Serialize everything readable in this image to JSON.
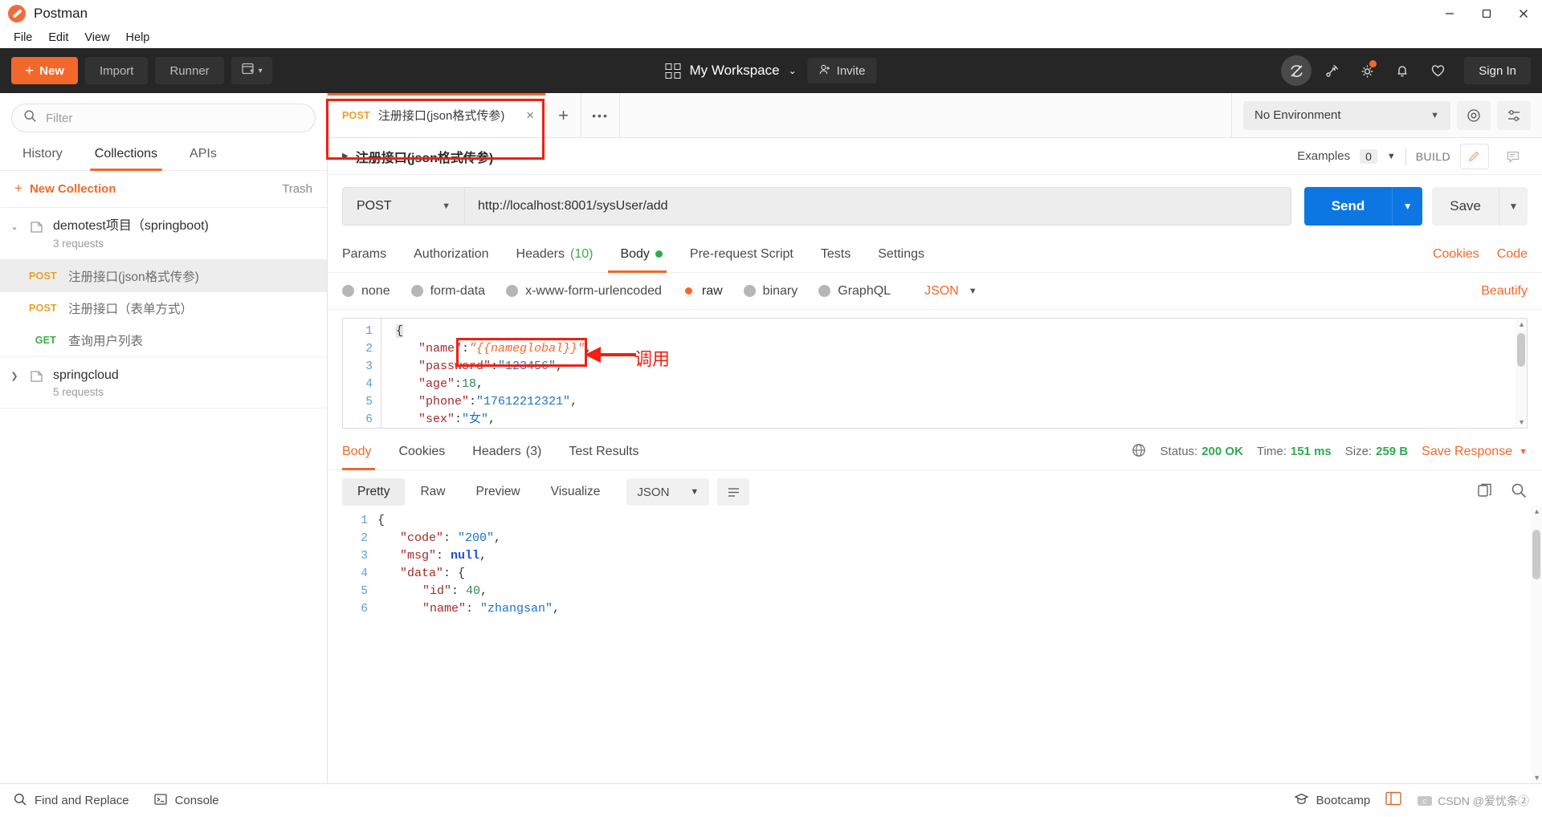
{
  "window": {
    "app_title": "Postman",
    "minimize": "minimize-icon",
    "maximize": "maximize-icon",
    "close": "close-icon"
  },
  "menubar": {
    "items": [
      "File",
      "Edit",
      "View",
      "Help"
    ]
  },
  "toolbar": {
    "new_label": "New",
    "import_label": "Import",
    "runner_label": "Runner",
    "workspace_label": "My Workspace",
    "invite_label": "Invite",
    "signin_label": "Sign In",
    "icons": [
      "sync-off-icon",
      "broadcast-icon",
      "gear-icon",
      "bell-icon",
      "heart-icon"
    ]
  },
  "sidebar": {
    "filter_placeholder": "Filter",
    "tabs": [
      {
        "label": "History",
        "active": false
      },
      {
        "label": "Collections",
        "active": true
      },
      {
        "label": "APIs",
        "active": false
      }
    ],
    "new_collection_label": "New Collection",
    "trash_label": "Trash",
    "collections": [
      {
        "name": "demotest项目（springboot)",
        "requests_label": "3 requests",
        "expanded": true,
        "items": [
          {
            "method": "POST",
            "name": "注册接口(json格式传参)",
            "selected": true
          },
          {
            "method": "POST",
            "name": "注册接口（表单方式）",
            "selected": false
          },
          {
            "method": "GET",
            "name": "查询用户列表",
            "selected": false
          }
        ]
      },
      {
        "name": "springcloud",
        "requests_label": "5 requests",
        "expanded": false,
        "items": []
      }
    ]
  },
  "tabstrip": {
    "tab": {
      "method": "POST",
      "title": "注册接口(json格式传参)",
      "close": "×"
    },
    "add_tab": "+",
    "more_tabs": "000",
    "environment": "No Environment",
    "eye_icon": "eye-icon",
    "settings_icon": "sliders-icon"
  },
  "breadcrumb": {
    "title": "注册接口(json格式传参)",
    "examples_label": "Examples",
    "examples_count": "0",
    "build_label": "BUILD",
    "edit_icon": "pencil-icon",
    "comment_icon": "comment-icon"
  },
  "request": {
    "method": "POST",
    "url": "http://localhost:8001/sysUser/add",
    "send_label": "Send",
    "save_label": "Save",
    "tabs": [
      {
        "label": "Params",
        "active": false
      },
      {
        "label": "Authorization",
        "active": false
      },
      {
        "label": "Headers",
        "count": "(10)",
        "active": false
      },
      {
        "label": "Body",
        "dot": true,
        "active": true
      },
      {
        "label": "Pre-request Script",
        "active": false
      },
      {
        "label": "Tests",
        "active": false
      },
      {
        "label": "Settings",
        "active": false
      }
    ],
    "cookies_link": "Cookies",
    "code_link": "Code",
    "body_types": [
      {
        "label": "none",
        "selected": false
      },
      {
        "label": "form-data",
        "selected": false
      },
      {
        "label": "x-www-form-urlencoded",
        "selected": false
      },
      {
        "label": "raw",
        "selected": true
      },
      {
        "label": "binary",
        "selected": false
      },
      {
        "label": "GraphQL",
        "selected": false
      }
    ],
    "raw_format": "JSON",
    "beautify_label": "Beautify",
    "body_lines": [
      "1",
      "2",
      "3",
      "4",
      "5",
      "6"
    ],
    "body_json": {
      "line1": "{",
      "line2_key": "\"name\"",
      "line2_colon": ":",
      "line2_val": "\"{{nameglobal}}\"",
      "line2_comma": ",",
      "line3_key": "\"password\"",
      "line3_val": "\"123456\"",
      "line4_key": "\"age\"",
      "line4_val": "18",
      "line5_key": "\"phone\"",
      "line5_val": "\"17612212321\"",
      "line6_key": "\"sex\"",
      "line6_val": "\"女\""
    }
  },
  "response": {
    "tabs": [
      {
        "label": "Body",
        "active": true
      },
      {
        "label": "Cookies",
        "active": false
      },
      {
        "label": "Headers",
        "count": "(3)",
        "active": false
      },
      {
        "label": "Test Results",
        "active": false
      }
    ],
    "globe_icon": "globe-icon",
    "status_label": "Status:",
    "status_value": "200 OK",
    "time_label": "Time:",
    "time_value": "151 ms",
    "size_label": "Size:",
    "size_value": "259 B",
    "save_response_label": "Save Response",
    "view_modes": [
      {
        "label": "Pretty",
        "active": true
      },
      {
        "label": "Raw",
        "active": false
      },
      {
        "label": "Preview",
        "active": false
      },
      {
        "label": "Visualize",
        "active": false
      }
    ],
    "format": "JSON",
    "wrap_icon": "wrap-lines-icon",
    "copy_icon": "copy-icon",
    "search_icon": "search-icon",
    "body_lines": [
      "1",
      "2",
      "3",
      "4",
      "5",
      "6"
    ],
    "body_json": {
      "line1": "{",
      "line2_key": "\"code\"",
      "line2_val": "\"200\"",
      "line3_key": "\"msg\"",
      "line3_val": "null",
      "line4_key": "\"data\"",
      "line4_val": "{",
      "line5_key": "\"id\"",
      "line5_val": "40",
      "line6_key": "\"name\"",
      "line6_val": "\"zhangsan\""
    }
  },
  "statusbar": {
    "find_replace": "Find and Replace",
    "console": "Console",
    "bootcamp": "Bootcamp",
    "watermark": "CSDN @爱忧条②"
  },
  "annotations": {
    "call_label": "调用"
  }
}
